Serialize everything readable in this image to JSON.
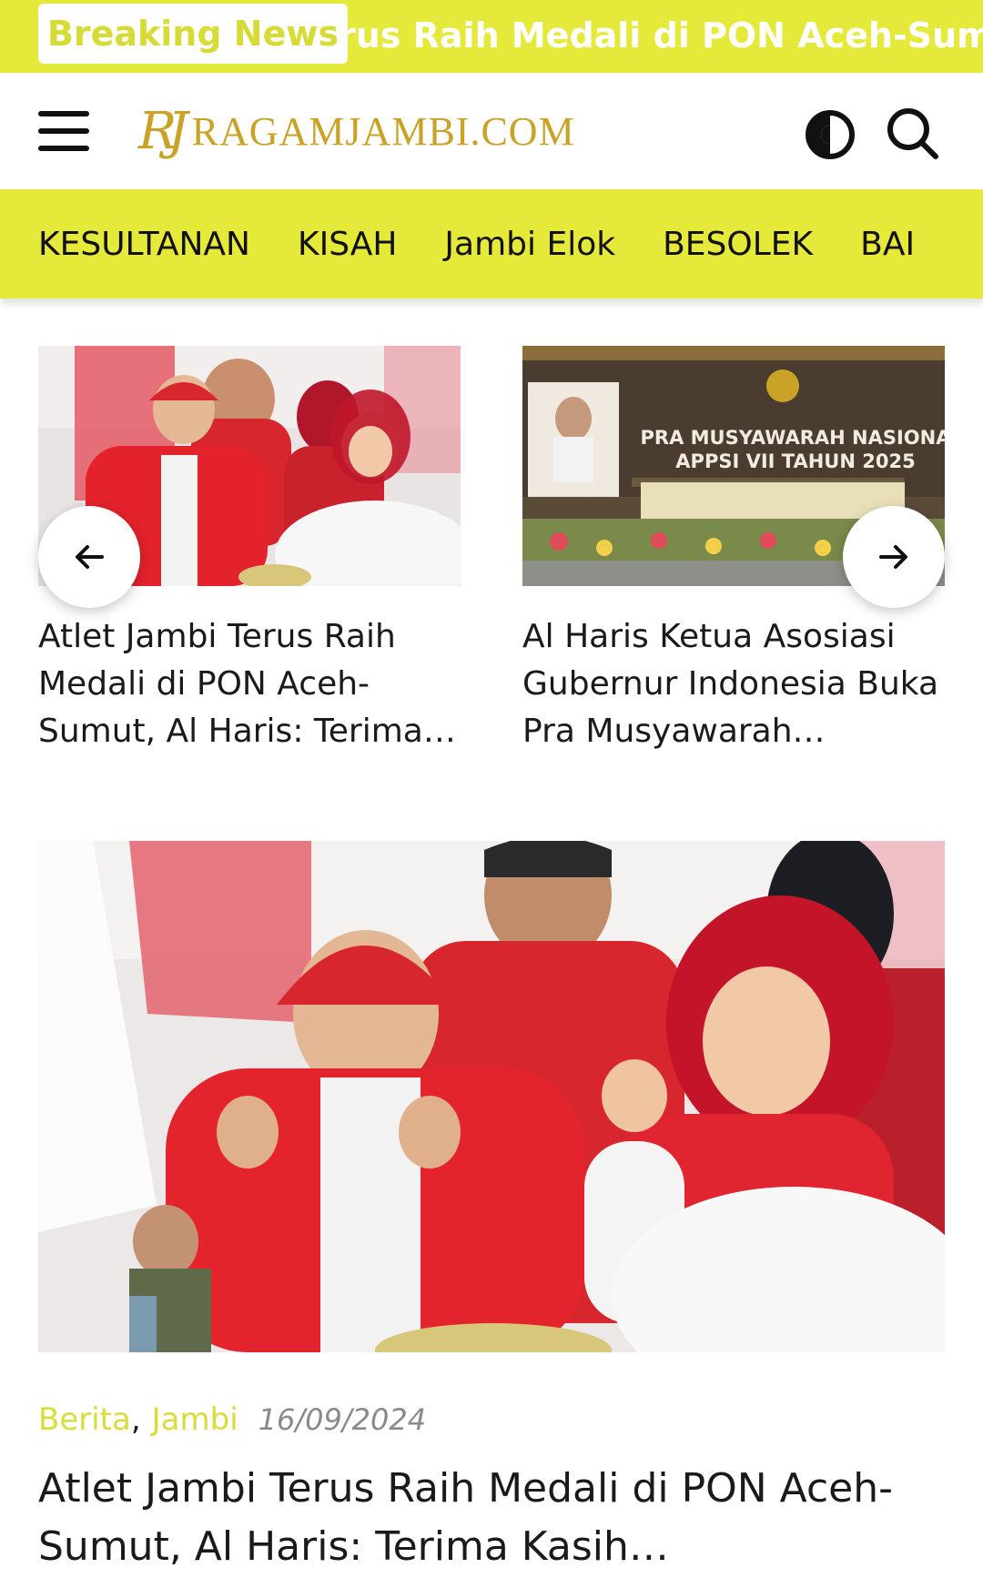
{
  "breaking": {
    "label": "Breaking News",
    "ticker": "rus Raih Medali di PON Aceh-Sumu"
  },
  "header": {
    "logo_mark": "RJ",
    "logo_text": "RAGAMJAMBI.COM"
  },
  "categories": [
    "KESULTANAN",
    "KISAH",
    "Jambi Elok",
    "BESOLEK",
    "BAI"
  ],
  "carousel": {
    "items": [
      {
        "title": "Atlet Jambi Terus Raih Medali di PON Aceh-Sumut, Al Haris: Terima…"
      },
      {
        "title": "Al Haris Ketua Asosiasi Gubernur Indonesia Buka Pra Musyawarah…",
        "banner_line1": "PRA MUSYAWARAH NASIONA",
        "banner_line2": "APPSI VII TAHUN 2025"
      }
    ]
  },
  "featured": {
    "category_1": "Berita",
    "separator": ",",
    "category_2": "Jambi",
    "date": "16/09/2024",
    "headline": "Atlet Jambi Terus Raih Medali di PON Aceh-Sumut, Al Haris: Terima Kasih…"
  },
  "colors": {
    "accent_yellow": "#e4e93a",
    "logo_gold": "#c9a227",
    "jersey_red": "#d8262e"
  }
}
